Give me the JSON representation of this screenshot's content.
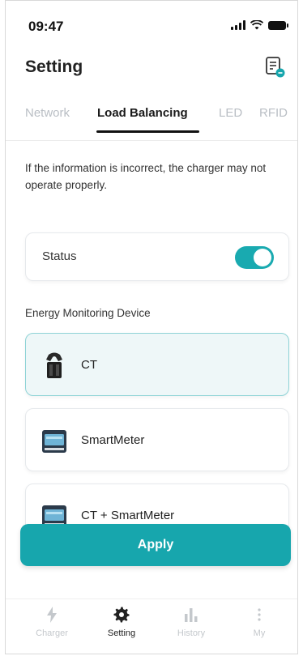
{
  "status_bar": {
    "time": "09:47"
  },
  "header": {
    "title": "Setting",
    "action_icon": "document-settings-icon"
  },
  "tabs": [
    {
      "label": "Network",
      "active": false
    },
    {
      "label": "Load Balancing",
      "active": true
    },
    {
      "label": "LED",
      "active": false
    },
    {
      "label": "RFID",
      "active": false
    }
  ],
  "notice": "If the information is incorrect, the charger may not operate properly.",
  "status": {
    "label": "Status",
    "enabled": true
  },
  "energy_monitoring": {
    "section_label": "Energy Monitoring Device",
    "devices": [
      {
        "label": "CT",
        "icon": "ct-clamp-icon",
        "selected": true
      },
      {
        "label": "SmartMeter",
        "icon": "smart-meter-icon",
        "selected": false
      },
      {
        "label": "CT + SmartMeter",
        "icon": "smart-meter-icon",
        "selected": false
      }
    ]
  },
  "apply_label": "Apply",
  "bottom_nav": [
    {
      "label": "Charger",
      "icon": "lightning-icon",
      "active": false
    },
    {
      "label": "Setting",
      "icon": "gear-icon",
      "active": true
    },
    {
      "label": "History",
      "icon": "bar-chart-icon",
      "active": false
    },
    {
      "label": "My",
      "icon": "more-vertical-icon",
      "active": false
    }
  ],
  "colors": {
    "accent": "#17a6ad",
    "selected_bg": "#eef7f8",
    "inactive": "#c4c8cc"
  }
}
